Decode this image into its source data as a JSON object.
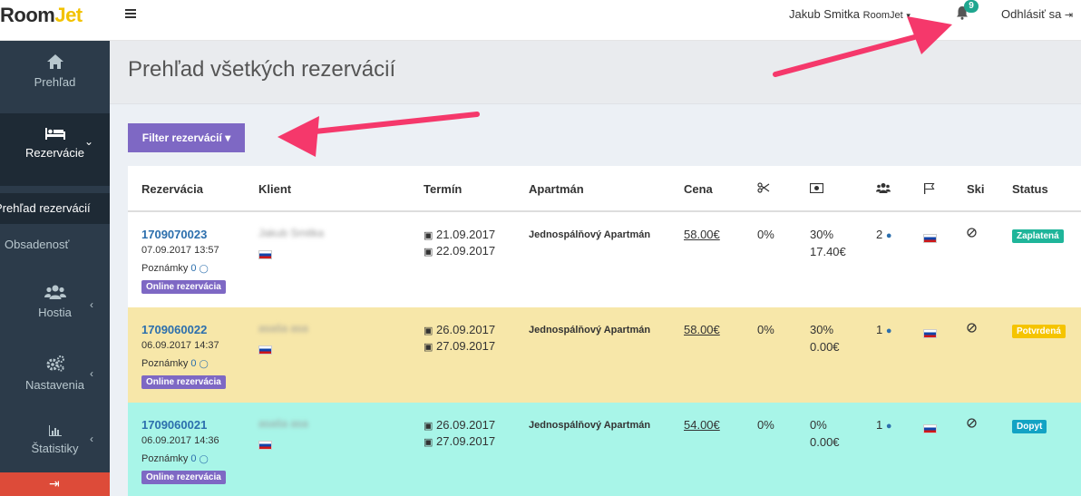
{
  "app": {
    "logo_room": "Room",
    "logo_jet": "Jet"
  },
  "topbar": {
    "user_name": "Jakub Smitka",
    "user_brand": "RoomJet",
    "notifications_count": "9",
    "logout_label": "Odhlásiť sa"
  },
  "sidebar": {
    "items": [
      {
        "label": "Prehľad",
        "icon": "home-icon"
      },
      {
        "label": "Rezervácie",
        "icon": "bed-icon"
      },
      {
        "label": "Hostia",
        "icon": "users-icon"
      },
      {
        "label": "Nastavenia",
        "icon": "gears-icon"
      },
      {
        "label": "Štatistiky",
        "icon": "bar-chart-icon"
      }
    ],
    "submenu": [
      {
        "label": "Prehľad rezervácií"
      },
      {
        "label": "Obsadenosť"
      }
    ]
  },
  "page": {
    "title": "Prehľad všetkých rezervácií"
  },
  "filter": {
    "label": "Filter rezervácií"
  },
  "table": {
    "headers": [
      "Rezervácia",
      "Klient",
      "Termín",
      "Apartmán",
      "Cena",
      "Ski",
      "Status"
    ],
    "rows": [
      {
        "id": "1709070023",
        "created": "07.09.2017 13:57",
        "notes_label": "Poznámky",
        "notes_count": "0",
        "source": "Online rezervácia",
        "client": "Jakub Smitka",
        "from": "21.09.2017",
        "to": "22.09.2017",
        "apartment": "Jednospálňový Apartmán",
        "price": "58.00€",
        "discount": "0%",
        "deposit_pct": "30%",
        "deposit_amount": "17.40€",
        "guests": "2",
        "status": "Zaplatená",
        "status_color": "#1fb59a",
        "row_color": "#ffffff"
      },
      {
        "id": "1709060022",
        "created": "06.09.2017 14:37",
        "notes_label": "Poznámky",
        "notes_count": "0",
        "source": "Online rezervácia",
        "client": "asaša asa",
        "from": "26.09.2017",
        "to": "27.09.2017",
        "apartment": "Jednospálňový Apartmán",
        "price": "58.00€",
        "discount": "0%",
        "deposit_pct": "30%",
        "deposit_amount": "0.00€",
        "guests": "1",
        "status": "Potvrdená",
        "status_color": "#f5c400",
        "row_color": "#f7e7a9"
      },
      {
        "id": "1709060021",
        "created": "06.09.2017 14:36",
        "notes_label": "Poznámky",
        "notes_count": "0",
        "source": "Online rezervácia",
        "client": "asaša asa",
        "from": "26.09.2017",
        "to": "27.09.2017",
        "apartment": "Jednospálňový Apartmán",
        "price": "54.00€",
        "discount": "0%",
        "deposit_pct": "0%",
        "deposit_amount": "0.00€",
        "guests": "1",
        "status": "Dopyt",
        "status_color": "#12a3c4",
        "row_color": "#a8f5e8"
      }
    ]
  }
}
